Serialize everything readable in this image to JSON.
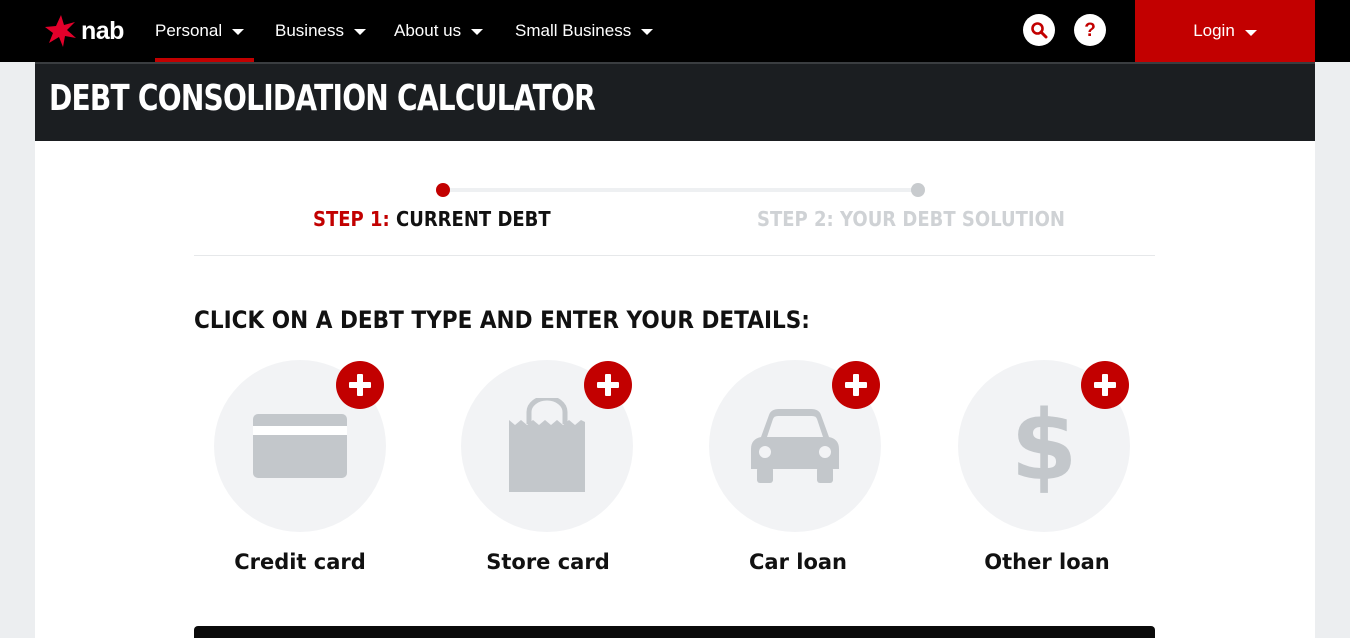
{
  "brand": {
    "name": "nab",
    "accent_color": "#c20000",
    "icon": "nab-star-logo"
  },
  "nav": {
    "items": [
      {
        "label": "Personal",
        "active": true
      },
      {
        "label": "Business",
        "active": false
      },
      {
        "label": "About us",
        "active": false
      },
      {
        "label": "Small Business",
        "active": false
      }
    ],
    "search_icon": "search-icon",
    "help_icon": "help-icon",
    "help_glyph": "?",
    "login_label": "Login"
  },
  "page": {
    "title": "DEBT CONSOLIDATION CALCULATOR"
  },
  "steps": [
    {
      "number": "STEP 1:",
      "name": "CURRENT DEBT",
      "state": "current"
    },
    {
      "number": "STEP 2:",
      "name": "YOUR DEBT SOLUTION",
      "state": "upcoming"
    }
  ],
  "instruction": "CLICK ON A DEBT TYPE AND ENTER YOUR DETAILS:",
  "debt_types": [
    {
      "label": "Credit card",
      "icon": "credit-card-icon"
    },
    {
      "label": "Store card",
      "icon": "shopping-bag-icon"
    },
    {
      "label": "Car loan",
      "icon": "car-icon"
    },
    {
      "label": "Other loan",
      "icon": "dollar-icon",
      "glyph": "$"
    }
  ]
}
